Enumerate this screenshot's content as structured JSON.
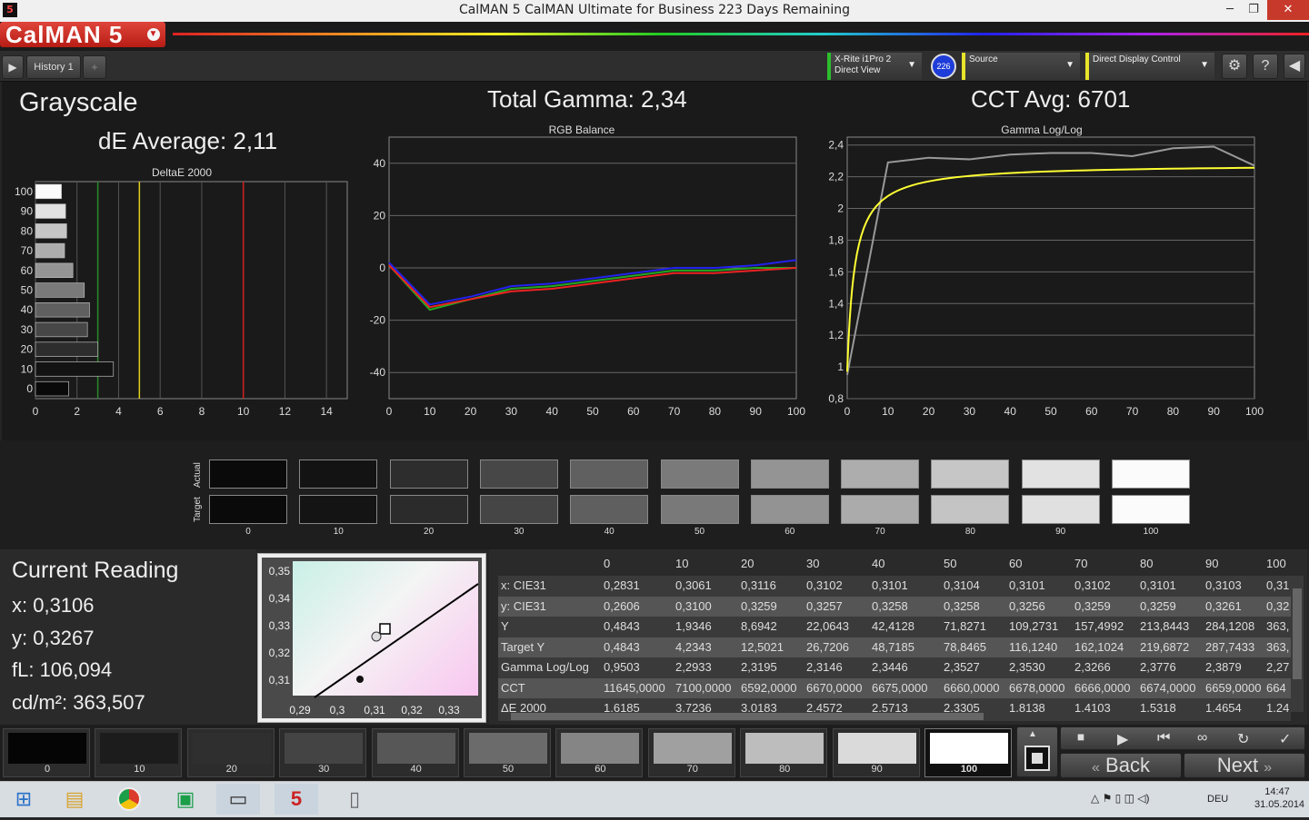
{
  "window": {
    "title": "CalMAN 5 CalMAN Ultimate for Business 223 Days Remaining",
    "app_icon": "5",
    "minimize": "─",
    "restore": "❐",
    "close": "✕"
  },
  "brand": {
    "logo": "CalMAN 5"
  },
  "tabs": {
    "history_label": "History 1",
    "add": "+"
  },
  "devices": {
    "meter_line1": "X-Rite i1Pro 2",
    "meter_line2": "Direct View",
    "meter_badge": "226",
    "source": "Source",
    "display": "Direct Display Control"
  },
  "header": {
    "title": "Grayscale",
    "de_avg": "dE Average: 2,11",
    "gamma": "Total Gamma: 2,34",
    "cct": "CCT Avg: 6701"
  },
  "charts": {
    "deltae_title": "DeltaE 2000",
    "rgb_title": "RGB Balance",
    "gamma_title": "Gamma Log/Log"
  },
  "chart_data": [
    {
      "type": "bar",
      "title": "DeltaE 2000",
      "categories": [
        "100",
        "90",
        "80",
        "70",
        "60",
        "50",
        "40",
        "30",
        "20",
        "10",
        "0"
      ],
      "values": [
        1.25,
        1.45,
        1.5,
        1.4,
        1.8,
        2.35,
        2.6,
        2.5,
        3.0,
        3.75,
        1.6
      ],
      "xlim": [
        0,
        15
      ],
      "xticks": [
        "0",
        "2",
        "4",
        "6",
        "8",
        "10",
        "12",
        "14"
      ],
      "reference_lines": [
        {
          "value": 3,
          "color": "#2a8a2a"
        },
        {
          "value": 5,
          "color": "#e0d020"
        },
        {
          "value": 10,
          "color": "#d02020"
        }
      ]
    },
    {
      "type": "line",
      "title": "RGB Balance",
      "x": [
        0,
        10,
        20,
        30,
        40,
        50,
        60,
        70,
        80,
        90,
        100
      ],
      "ylim": [
        -50,
        50
      ],
      "yticks": [
        "40",
        "20",
        "0",
        "-20",
        "-40"
      ],
      "xticks": [
        "0",
        "10",
        "20",
        "30",
        "40",
        "50",
        "60",
        "70",
        "80",
        "90",
        "100"
      ],
      "series": [
        {
          "color": "#2222ee",
          "values": [
            2,
            -14,
            -11,
            -7,
            -6,
            -4,
            -2,
            0,
            0,
            1,
            3
          ]
        },
        {
          "color": "#22aa22",
          "values": [
            1,
            -16,
            -12,
            -8,
            -7,
            -5,
            -3,
            -1,
            -1,
            0,
            0
          ]
        },
        {
          "color": "#ee2222",
          "values": [
            1,
            -15,
            -12,
            -9,
            -8,
            -6,
            -4,
            -2,
            -2,
            -1,
            0
          ]
        }
      ]
    },
    {
      "type": "line",
      "title": "Gamma Log/Log",
      "x": [
        0,
        10,
        20,
        30,
        40,
        50,
        60,
        70,
        80,
        90,
        100
      ],
      "ylim": [
        0.8,
        2.45
      ],
      "yticks": [
        "2,4",
        "2,2",
        "2",
        "1,8",
        "1,6",
        "1,4",
        "1,2",
        "1",
        "0,8"
      ],
      "xticks": [
        "0",
        "10",
        "20",
        "30",
        "40",
        "50",
        "60",
        "70",
        "80",
        "90",
        "100"
      ],
      "series": [
        {
          "color": "#999999",
          "values": [
            0.95,
            2.29,
            2.32,
            2.31,
            2.34,
            2.35,
            2.35,
            2.33,
            2.38,
            2.39,
            2.27
          ]
        },
        {
          "color": "#ffff33",
          "target_gamma": 2.28
        }
      ]
    }
  ],
  "swatches": {
    "actual_label": "Actual",
    "target_label": "Target",
    "items": [
      {
        "label": "0",
        "actual": "#0a0a0a",
        "target": "#0a0a0a"
      },
      {
        "label": "10",
        "actual": "#131313",
        "target": "#141414"
      },
      {
        "label": "20",
        "actual": "#2d2d2d",
        "target": "#2b2b2b"
      },
      {
        "label": "30",
        "actual": "#474747",
        "target": "#454545"
      },
      {
        "label": "40",
        "actual": "#606060",
        "target": "#5f5f5f"
      },
      {
        "label": "50",
        "actual": "#7a7a7a",
        "target": "#797979"
      },
      {
        "label": "60",
        "actual": "#949494",
        "target": "#939393"
      },
      {
        "label": "70",
        "actual": "#adadad",
        "target": "#ababab"
      },
      {
        "label": "80",
        "actual": "#c6c6c6",
        "target": "#c4c4c4"
      },
      {
        "label": "90",
        "actual": "#e2e2e2",
        "target": "#e0e0e0"
      },
      {
        "label": "100",
        "actual": "#fbfbfb",
        "target": "#fbfbfb"
      }
    ]
  },
  "reading": {
    "title": "Current Reading",
    "x": "x: 0,3106",
    "y": "y: 0,3267",
    "fl": "fL: 106,094",
    "cdm": "cd/m²: 363,507"
  },
  "cie": {
    "yticks": [
      "0,35",
      "0,34",
      "0,33",
      "0,32",
      "0,31"
    ],
    "xticks": [
      "0,29",
      "0,3",
      "0,31",
      "0,32",
      "0,33"
    ]
  },
  "table": {
    "columns": [
      "0",
      "10",
      "20",
      "30",
      "40",
      "50",
      "60",
      "70",
      "80",
      "90",
      "100"
    ],
    "rows": [
      {
        "label": "x: CIE31",
        "values": [
          "0,2831",
          "0,3061",
          "0,3116",
          "0,3102",
          "0,3101",
          "0,3104",
          "0,3101",
          "0,3102",
          "0,3101",
          "0,3103",
          "0,31"
        ]
      },
      {
        "label": "y: CIE31",
        "values": [
          "0,2606",
          "0,3100",
          "0,3259",
          "0,3257",
          "0,3258",
          "0,3258",
          "0,3256",
          "0,3259",
          "0,3259",
          "0,3261",
          "0,32"
        ]
      },
      {
        "label": "Y",
        "values": [
          "0,4843",
          "1,9346",
          "8,6942",
          "22,0643",
          "42,4128",
          "71,8271",
          "109,2731",
          "157,4992",
          "213,8443",
          "284,1208",
          "363,"
        ]
      },
      {
        "label": "Target Y",
        "values": [
          "0,4843",
          "4,2343",
          "12,5021",
          "26,7206",
          "48,7185",
          "78,8465",
          "116,1240",
          "162,1024",
          "219,6872",
          "287,7433",
          "363,"
        ]
      },
      {
        "label": "Gamma Log/Log",
        "values": [
          "0,9503",
          "2,2933",
          "2,3195",
          "2,3146",
          "2,3446",
          "2,3527",
          "2,3530",
          "2,3266",
          "2,3776",
          "2,3879",
          "2,27"
        ]
      },
      {
        "label": "CCT",
        "values": [
          "11645,0000",
          "7100,0000",
          "6592,0000",
          "6670,0000",
          "6675,0000",
          "6660,0000",
          "6678,0000",
          "6666,0000",
          "6674,0000",
          "6659,0000",
          "664"
        ]
      },
      {
        "label": "ΔE 2000",
        "values": [
          "1,6185",
          "3,7236",
          "3,0183",
          "2,4572",
          "2,5713",
          "2,3305",
          "1,8138",
          "1,4103",
          "1,5318",
          "1,4654",
          "1,24"
        ]
      }
    ]
  },
  "steps": [
    {
      "label": "0",
      "color": "#050505"
    },
    {
      "label": "10",
      "color": "#1c1c1c"
    },
    {
      "label": "20",
      "color": "#2f2f2f"
    },
    {
      "label": "30",
      "color": "#444"
    },
    {
      "label": "40",
      "color": "#575757"
    },
    {
      "label": "50",
      "color": "#6b6b6b"
    },
    {
      "label": "60",
      "color": "#858585"
    },
    {
      "label": "70",
      "color": "#a0a0a0"
    },
    {
      "label": "80",
      "color": "#bdbdbd"
    },
    {
      "label": "90",
      "color": "#dadada"
    },
    {
      "label": "100",
      "color": "#ffffff"
    }
  ],
  "nav": {
    "back": "Back",
    "next": "Next"
  },
  "taskbar": {
    "lang": "DEU",
    "time": "14:47",
    "date": "31.05.2014"
  }
}
